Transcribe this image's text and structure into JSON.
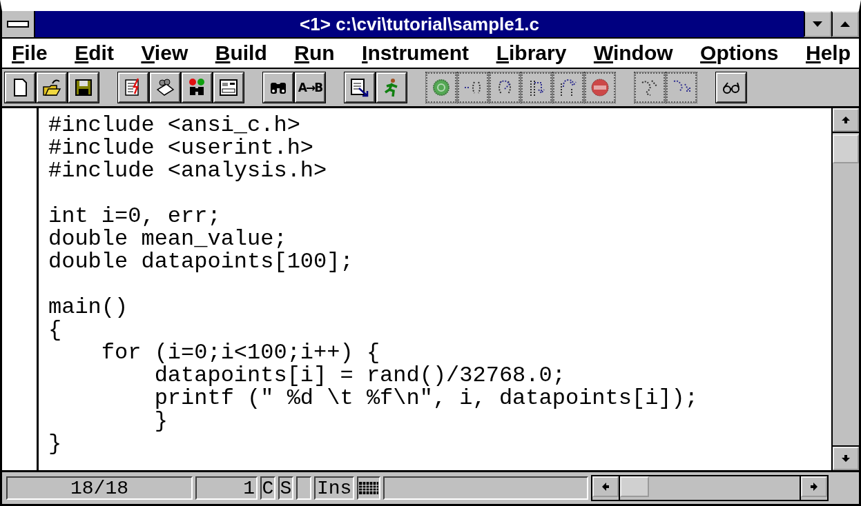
{
  "window": {
    "title": "<1> c:\\cvi\\tutorial\\sample1.c"
  },
  "menu": [
    {
      "label": "File"
    },
    {
      "label": "Edit"
    },
    {
      "label": "View"
    },
    {
      "label": "Build"
    },
    {
      "label": "Run"
    },
    {
      "label": "Instrument"
    },
    {
      "label": "Library"
    },
    {
      "label": "Window"
    },
    {
      "label": "Options"
    },
    {
      "label": "Help"
    }
  ],
  "toolbar": [
    {
      "group": [
        {
          "kind": "new",
          "disabled": false
        },
        {
          "kind": "open",
          "disabled": false
        },
        {
          "kind": "save",
          "disabled": false
        }
      ]
    },
    {
      "group": [
        {
          "kind": "edit",
          "disabled": false
        },
        {
          "kind": "tree",
          "disabled": false
        },
        {
          "kind": "watch",
          "disabled": false
        },
        {
          "kind": "panel",
          "disabled": false
        }
      ]
    },
    {
      "group": [
        {
          "kind": "find",
          "disabled": false
        },
        {
          "kind": "replace",
          "label": "A→B",
          "disabled": false
        }
      ]
    },
    {
      "group": [
        {
          "kind": "list",
          "disabled": false
        },
        {
          "kind": "run",
          "disabled": false
        }
      ]
    },
    {
      "group": [
        {
          "kind": "go",
          "disabled": true
        },
        {
          "kind": "step-into",
          "disabled": true
        },
        {
          "kind": "step-over",
          "disabled": true
        },
        {
          "kind": "finish",
          "disabled": true
        },
        {
          "kind": "step-up",
          "disabled": true
        },
        {
          "kind": "stop",
          "disabled": true
        }
      ]
    },
    {
      "group": [
        {
          "kind": "trace",
          "disabled": true
        },
        {
          "kind": "trace-down",
          "disabled": true
        }
      ]
    },
    {
      "group": [
        {
          "kind": "glasses",
          "disabled": false
        }
      ]
    }
  ],
  "code_blocks": [
    [
      "#include <ansi_c.h>",
      "#include <userint.h>",
      "#include <analysis.h>"
    ],
    [
      "int i=0, err;",
      "double mean_value;",
      "double datapoints[100];"
    ],
    [
      "main()",
      "{",
      "    for (i=0;i<100;i++) {",
      "        datapoints[i] = rand()/32768.0;",
      "        printf (\" %d \\t %f\\n\", i, datapoints[i]);",
      "        }",
      "}"
    ]
  ],
  "status_bar": {
    "line": "18/18",
    "column": "1",
    "flag_1": "C",
    "flag_2": "S",
    "mode": "Ins"
  }
}
